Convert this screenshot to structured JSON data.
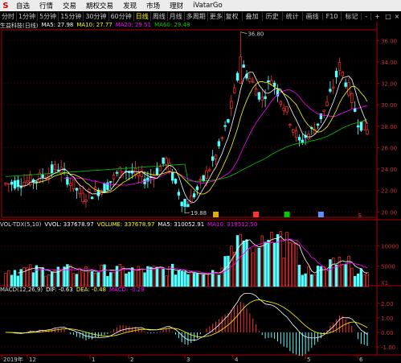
{
  "menu": {
    "logo": "S",
    "items": [
      "自选",
      "行情",
      "交易",
      "期权交易",
      "发现",
      "市场",
      "理财",
      "iVatarGo"
    ]
  },
  "toolbar": {
    "periods": [
      "分时",
      "1分钟",
      "5分钟",
      "15分钟",
      "30分钟",
      "60分钟",
      "日线",
      "周线",
      "月线",
      "多周期",
      "更多"
    ],
    "active_period": "日线",
    "right_buttons": [
      "复权",
      "叠加",
      "历史",
      "统计",
      "画线",
      "F10",
      "标记",
      "-",
      "+"
    ],
    "window_buttons": [
      "□",
      "×"
    ]
  },
  "title_line": {
    "name": "生益科技(日线)",
    "ma5": "MA5: 27.98",
    "ma10": "MA10: 27.77",
    "ma20": "MA20: 29.51",
    "ma60": "MA60: 29.48"
  },
  "vol_line": {
    "label": "VOL-TDX(5,10)",
    "vvol": "VVOL: 337678.97",
    "volume": "VOLUME: 337678.97",
    "ma5": "MA5: 310052.91",
    "ma10": "MA10: 319512.50"
  },
  "macd_line": {
    "label": "MACD(12,26,9)",
    "dif": "DIF: -0.63",
    "dea": "DEA: -0.48",
    "macd": "MACD: -0.29"
  },
  "price_axis": [
    "36.00",
    "34.00",
    "32.00",
    "30.00",
    "28.00",
    "26.00",
    "24.00",
    "22.00",
    "20.00"
  ],
  "vol_axis": [
    "10000",
    "5000"
  ],
  "vol_unit": "X1",
  "macd_axis": [
    "2.00",
    "1.00",
    "0.00",
    "-1.00"
  ],
  "annotations": {
    "high": "36.80",
    "low": "19.88"
  },
  "markers": [
    "减",
    "购",
    "跌",
    "跌"
  ],
  "marker_letter": "S",
  "x_labels": [
    "2019年",
    "12",
    "1",
    "2",
    "3",
    "4",
    "5",
    "6"
  ],
  "colors": {
    "up": "#ff3232",
    "down": "#54ffff",
    "ma5": "#ffffff",
    "ma10": "#ffff00",
    "ma20": "#ff00ff",
    "ma60": "#00c800",
    "axis": "#b00000",
    "grid": "#800000"
  }
}
